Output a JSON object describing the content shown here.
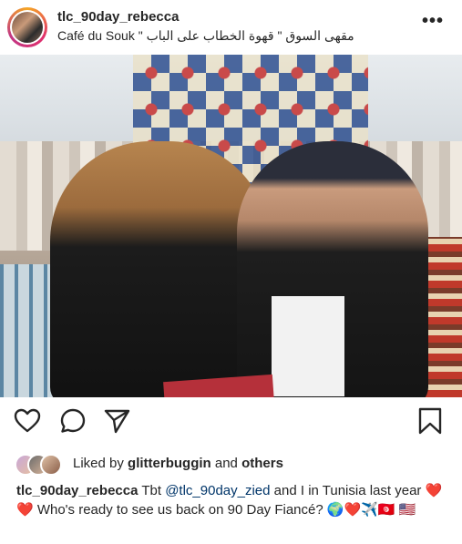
{
  "post": {
    "username": "tlc_90day_rebecca",
    "location": "Café du Souk  \" مقهى السوق \" قهوة الخطاب على الباب",
    "more_label": "•••"
  },
  "likes": {
    "liked_by_prefix": "Liked by",
    "liked_by_user": "glitterbuggin",
    "and_label": "and",
    "others_label": "others"
  },
  "caption": {
    "username": "tlc_90day_rebecca",
    "text_1": " Tbt ",
    "mention": "@tlc_90day_zied",
    "text_2": " and I in Tunisia last year ❤️❤️ Who's ready to see us back on 90 Day Fiancé? 🌍❤️✈️🇹🇳 🇺🇸"
  },
  "icons": {
    "like": "heart-icon",
    "comment": "comment-icon",
    "share": "send-icon",
    "save": "bookmark-icon",
    "more": "more-icon"
  },
  "colors": {
    "text": "#262626",
    "mention": "#003569",
    "avatar_ring": "#e1306c"
  }
}
